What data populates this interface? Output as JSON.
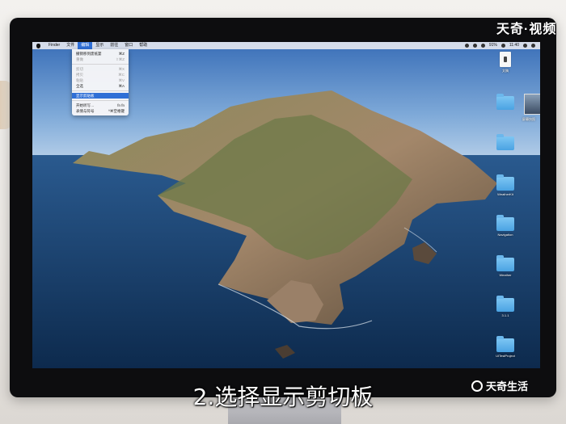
{
  "menubar": {
    "items": [
      "Finder",
      "文件",
      "编辑",
      "显示",
      "前往",
      "窗口",
      "帮助"
    ],
    "active_index": 2,
    "right": {
      "battery": "91%",
      "time": "11:40"
    }
  },
  "edit_menu": {
    "items": [
      {
        "label": "撤销移到废纸篓",
        "shortcut": "⌘Z",
        "state": "normal"
      },
      {
        "label": "重做",
        "shortcut": "⇧⌘Z",
        "state": "disabled"
      },
      {
        "sep": true
      },
      {
        "label": "剪切",
        "shortcut": "⌘X",
        "state": "disabled"
      },
      {
        "label": "拷贝",
        "shortcut": "⌘C",
        "state": "disabled"
      },
      {
        "label": "粘贴",
        "shortcut": "⌘V",
        "state": "disabled"
      },
      {
        "label": "全选",
        "shortcut": "⌘A",
        "state": "normal"
      },
      {
        "sep": true
      },
      {
        "label": "显示剪贴板",
        "shortcut": "",
        "state": "highlight"
      },
      {
        "sep": true
      },
      {
        "label": "开始听写…",
        "shortcut": "fn fn",
        "state": "normal"
      },
      {
        "label": "表情与符号",
        "shortcut": "^⌘空格键",
        "state": "normal"
      }
    ]
  },
  "desktop_icons": [
    {
      "type": "file",
      "label": "文稿"
    },
    {
      "type": "folder",
      "label": ""
    },
    {
      "type": "folder",
      "label": ""
    },
    {
      "type": "folder",
      "label": "WeatherKit"
    },
    {
      "type": "folder",
      "label": "Navigation"
    },
    {
      "type": "folder",
      "label": "Weather"
    },
    {
      "type": "folder",
      "label": "3.1.1"
    },
    {
      "type": "folder",
      "label": "UITestProject"
    }
  ],
  "thumbnail": {
    "label": "屏幕快照"
  },
  "watermark": {
    "top": "天奇·视频",
    "bottom": "天奇生活"
  },
  "caption": "2.选择显示剪切板"
}
